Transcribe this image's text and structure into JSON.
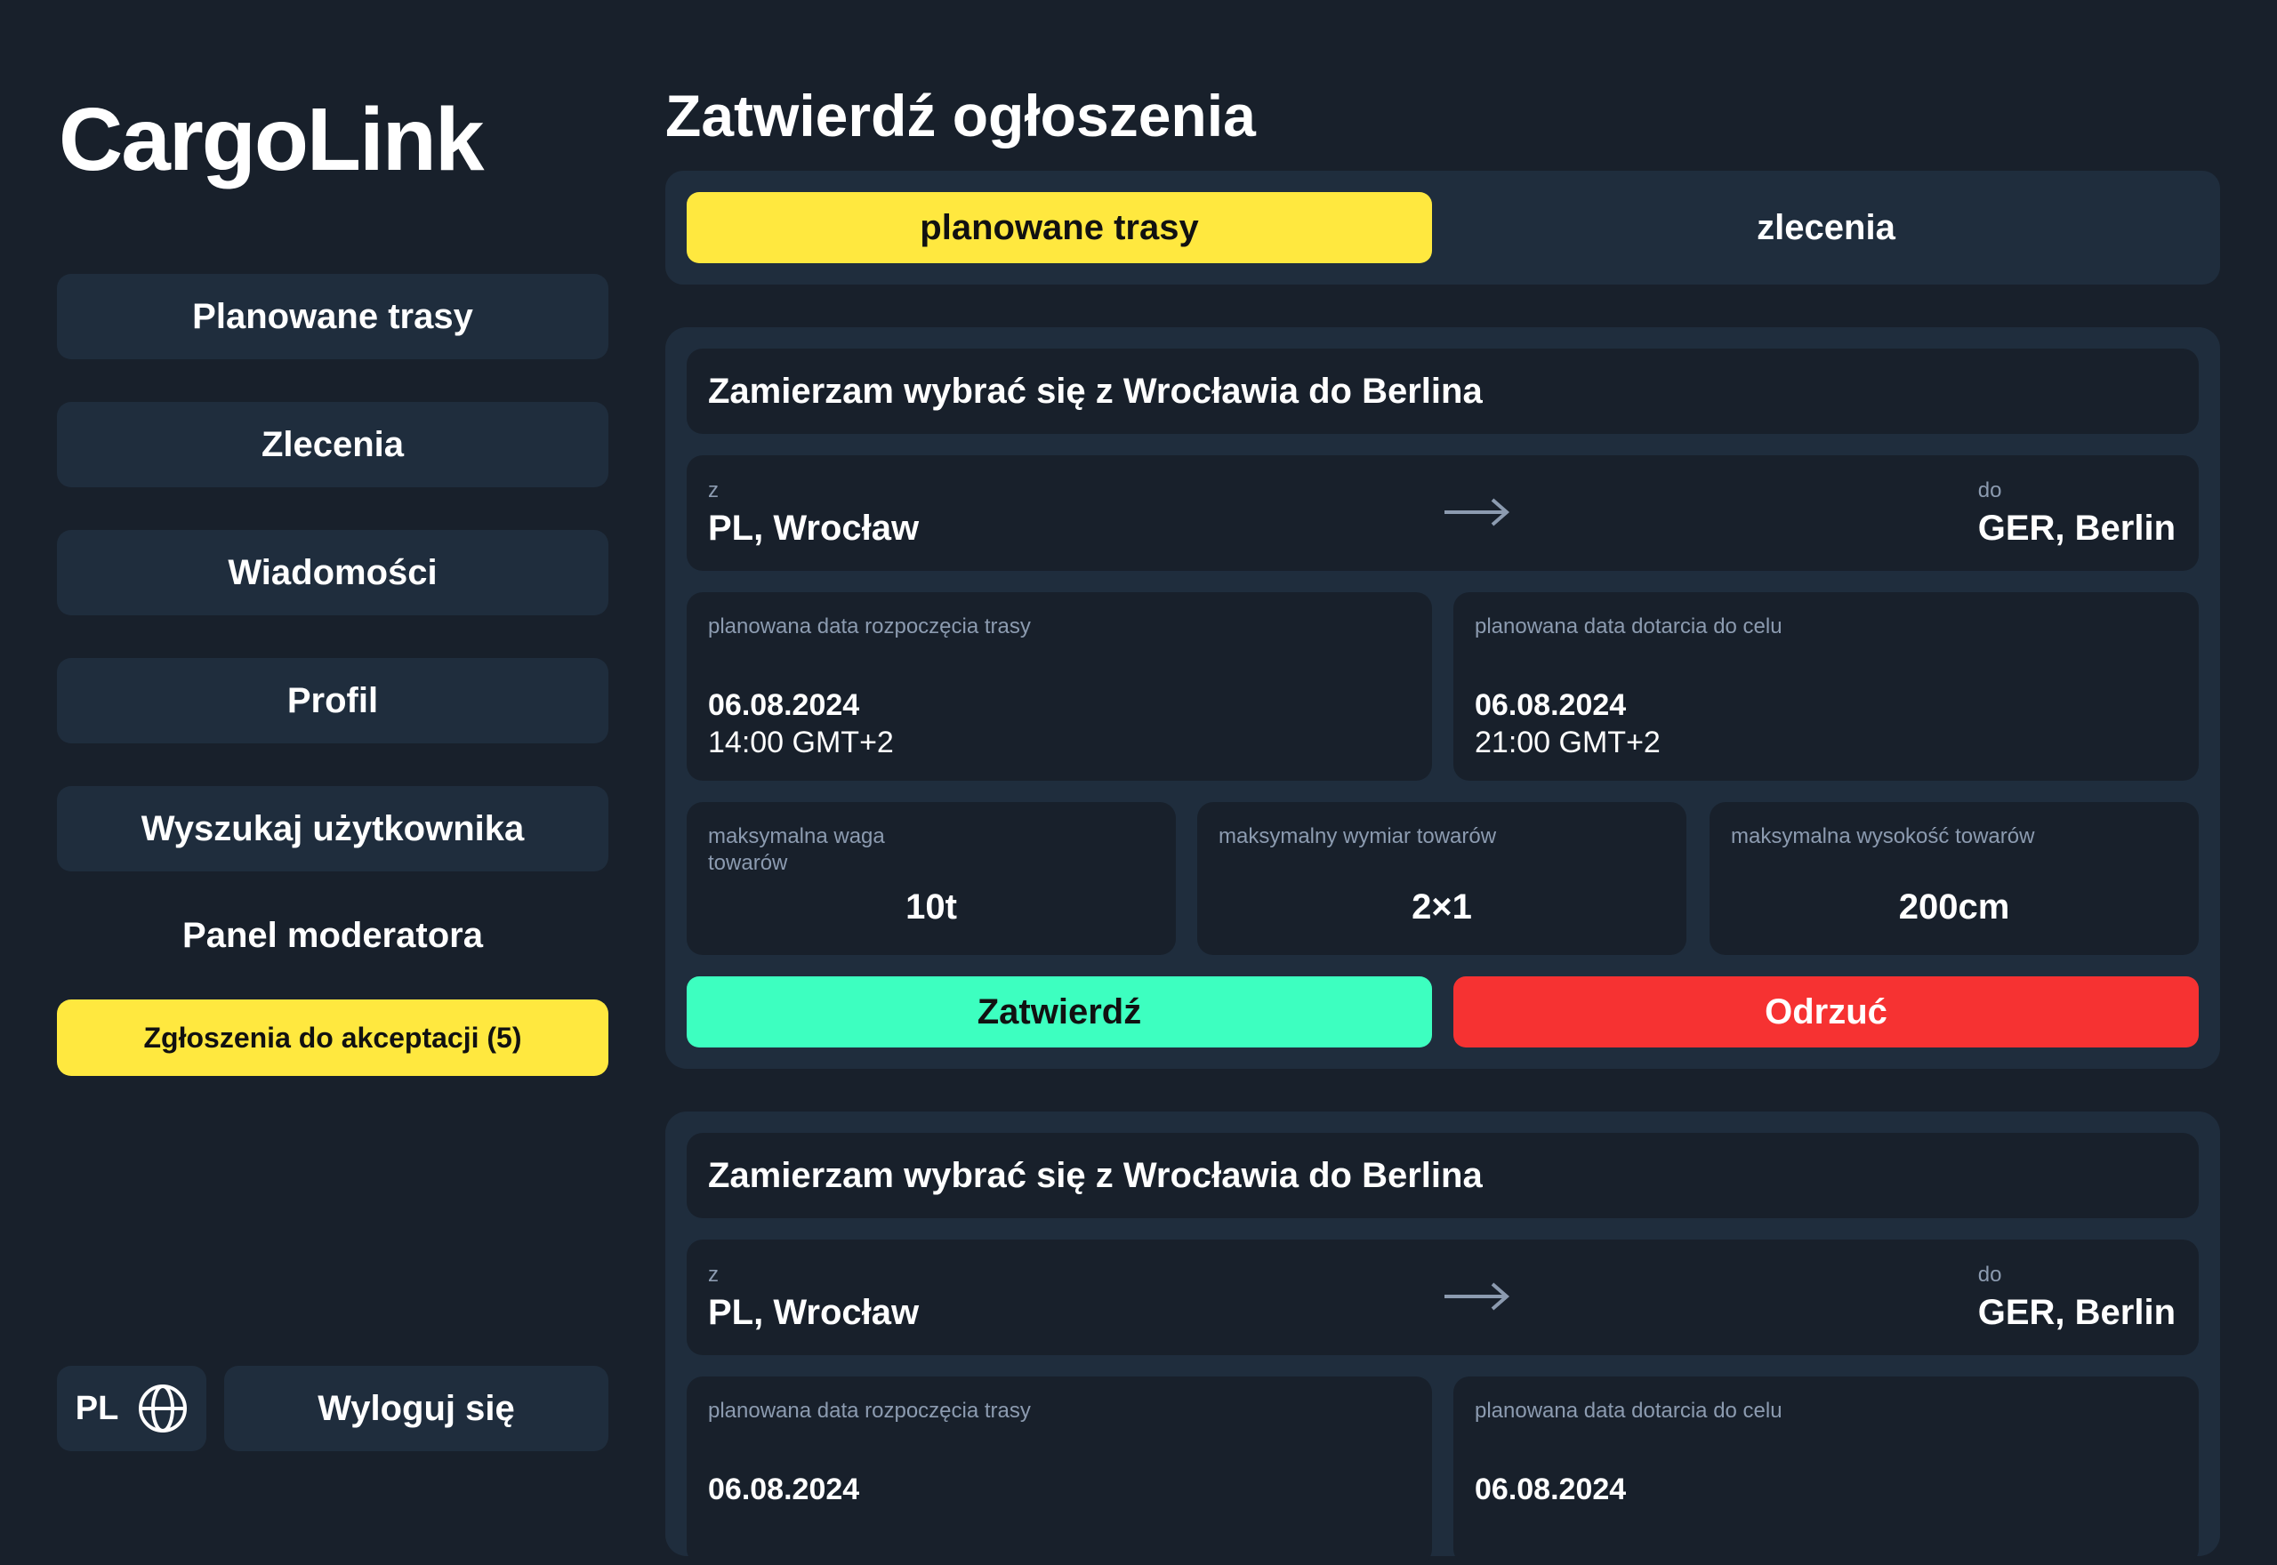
{
  "app": {
    "title": "CargoLink"
  },
  "sidebar": {
    "items": [
      {
        "label": "Planowane trasy"
      },
      {
        "label": "Zlecenia"
      },
      {
        "label": "Wiadomości"
      },
      {
        "label": "Profil"
      },
      {
        "label": "Wyszukaj użytkownika"
      }
    ],
    "section_label": "Panel moderatora",
    "pending_label": "Zgłoszenia do akceptacji (5)",
    "language": "PL",
    "logout_label": "Wyloguj się"
  },
  "main": {
    "title": "Zatwierdź ogłoszenia",
    "tabs": [
      {
        "label": "planowane trasy",
        "active": true
      },
      {
        "label": "zlecenia",
        "active": false
      }
    ],
    "cards": [
      {
        "title": "Zamierzam wybrać się z Wrocławia do Berlina",
        "from_label": "z",
        "from": "PL, Wrocław",
        "to_label": "do",
        "to": "GER, Berlin",
        "start_label": "planowana data rozpoczęcia trasy",
        "start_date": "06.08.2024",
        "start_time": "14:00 GMT+2",
        "end_label": "planowana data dotarcia do celu",
        "end_date": "06.08.2024",
        "end_time": "21:00 GMT+2",
        "weight_label": "maksymalna waga towarów",
        "weight": "10t",
        "dimension_label": "maksymalny wymiar towarów",
        "dimension": "2×1",
        "height_label": "maksymalna wysokość towarów",
        "height": "200cm",
        "approve_label": "Zatwierdź",
        "reject_label": "Odrzuć"
      },
      {
        "title": "Zamierzam wybrać się z Wrocławia do Berlina",
        "from_label": "z",
        "from": "PL, Wrocław",
        "to_label": "do",
        "to": "GER, Berlin",
        "start_label": "planowana data rozpoczęcia trasy",
        "start_date": "06.08.2024",
        "end_label": "planowana data dotarcia do celu",
        "end_date": "06.08.2024"
      }
    ]
  },
  "colors": {
    "background": "#18202b",
    "panel": "#1f2d3d",
    "accent_yellow": "#ffe83f",
    "approve_green": "#3dffc0",
    "reject_red": "#f63232",
    "muted_text": "#8c9bb0"
  },
  "icons": {
    "language": "globe-icon",
    "route": "arrow-right-icon"
  }
}
